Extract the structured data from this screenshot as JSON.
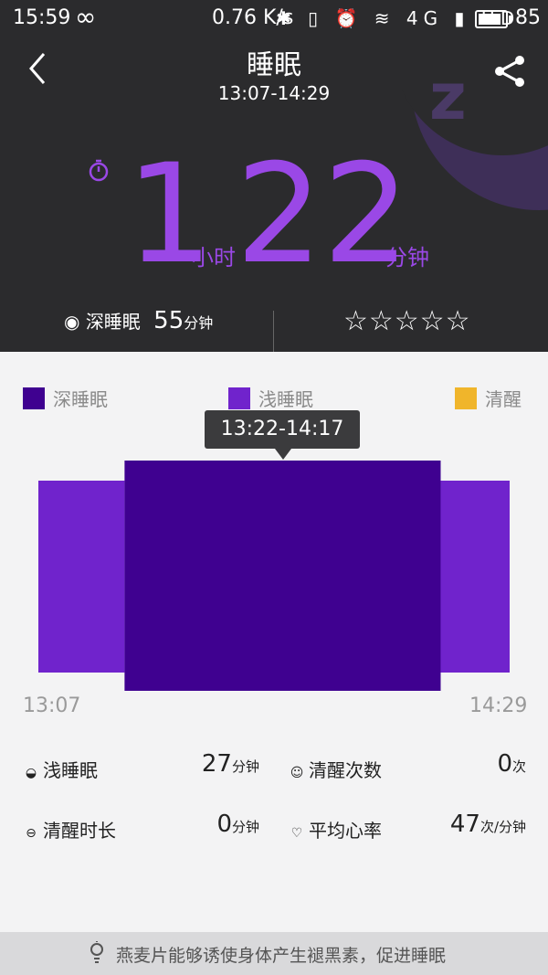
{
  "status_bar": {
    "time": "15:59",
    "loop": "∞",
    "speed": "0.76 K/s",
    "icons": "✱ ▯ ⏰ ≋ 4G ▮ HD",
    "battery": "85"
  },
  "header": {
    "title": "睡眠",
    "time_range": "13:07-14:29"
  },
  "duration": {
    "hours": "1",
    "hours_unit": "小时",
    "minutes": "22",
    "minutes_unit": "分钟"
  },
  "deep_sleep": {
    "label": "深睡眠",
    "value": "55",
    "unit": "分钟"
  },
  "rating": {
    "stars": "☆☆☆☆☆"
  },
  "legend": [
    {
      "label": "深睡眠",
      "color": "#3f0190"
    },
    {
      "label": "浅睡眠",
      "color": "#7023cc"
    },
    {
      "label": "清醒",
      "color": "#f0b52b"
    }
  ],
  "chart_data": {
    "type": "bar",
    "x_start": "13:07",
    "x_end": "14:29",
    "segments": [
      {
        "stage": "浅睡眠",
        "start": "13:07",
        "end": "13:22"
      },
      {
        "stage": "深睡眠",
        "start": "13:22",
        "end": "14:17"
      },
      {
        "stage": "浅睡眠",
        "start": "14:17",
        "end": "14:29"
      }
    ],
    "tooltip": "13:22-14:17"
  },
  "stats": {
    "light_sleep": {
      "label": "浅睡眠",
      "value": "27",
      "unit": "分钟"
    },
    "awake_count": {
      "label": "清醒次数",
      "value": "0",
      "unit": "次"
    },
    "awake_duration": {
      "label": "清醒时长",
      "value": "0",
      "unit": "分钟"
    },
    "avg_heart_rate": {
      "label": "平均心率",
      "value": "47",
      "unit": "次/分钟"
    }
  },
  "tip": "燕麦片能够诱使身体产生褪黑素，促进睡眠"
}
